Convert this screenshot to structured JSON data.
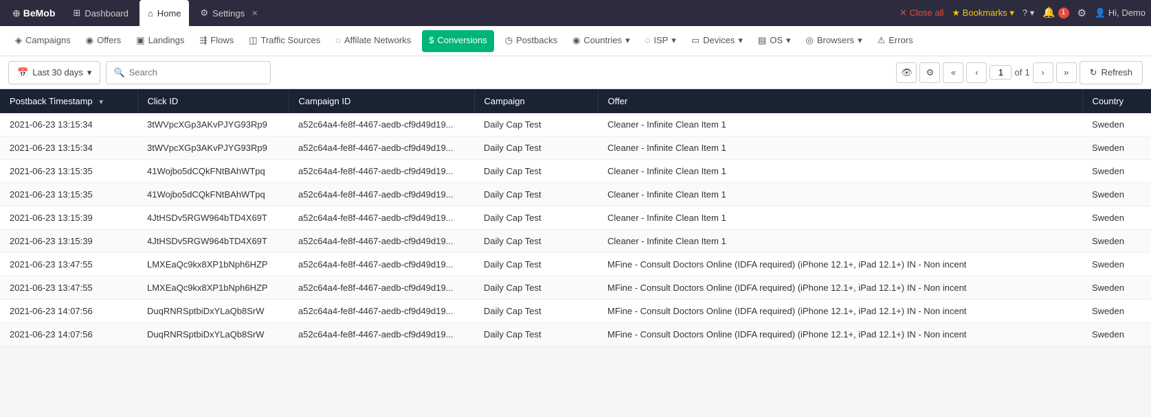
{
  "app": {
    "logo": "BeMob",
    "logo_icon": "⊕"
  },
  "tabs": [
    {
      "id": "dashboard",
      "label": "Dashboard",
      "icon": "⊞",
      "active": false,
      "closable": false
    },
    {
      "id": "home",
      "label": "Home",
      "icon": "⌂",
      "active": true,
      "closable": false
    },
    {
      "id": "settings",
      "label": "Settings",
      "icon": "⚙",
      "active": false,
      "closable": true
    }
  ],
  "topbar_right": {
    "close_all": "Close all",
    "bookmarks": "Bookmarks",
    "help_icon": "?",
    "notification_count": "1",
    "settings_icon": "⚙",
    "user": "Hi, Demo"
  },
  "navbar": {
    "items": [
      {
        "id": "campaigns",
        "label": "Campaigns",
        "icon": "◈"
      },
      {
        "id": "offers",
        "label": "Offers",
        "icon": "◉"
      },
      {
        "id": "landings",
        "label": "Landings",
        "icon": "▣"
      },
      {
        "id": "flows",
        "label": "Flows",
        "icon": "⇶"
      },
      {
        "id": "traffic-sources",
        "label": "Traffic Sources",
        "icon": "◫"
      },
      {
        "id": "affiliate-networks",
        "label": "Affilate Networks",
        "icon": "◌"
      },
      {
        "id": "conversions",
        "label": "Conversions",
        "icon": "$",
        "active": true
      },
      {
        "id": "postbacks",
        "label": "Postbacks",
        "icon": "◷"
      },
      {
        "id": "countries",
        "label": "Countries",
        "icon": "◉"
      },
      {
        "id": "isp",
        "label": "ISP",
        "icon": "◌"
      },
      {
        "id": "devices",
        "label": "Devices",
        "icon": "▭"
      },
      {
        "id": "os",
        "label": "OS",
        "icon": "▤"
      },
      {
        "id": "browsers",
        "label": "Browsers",
        "icon": "◎"
      },
      {
        "id": "errors",
        "label": "Errors",
        "icon": "⚠"
      }
    ]
  },
  "toolbar": {
    "date_range": "Last 30 days",
    "search_placeholder": "Search",
    "refresh_label": "Refresh",
    "page_current": "1",
    "page_total": "1"
  },
  "table": {
    "columns": [
      {
        "id": "timestamp",
        "label": "Postback Timestamp",
        "sortable": true
      },
      {
        "id": "clickid",
        "label": "Click ID",
        "sortable": false
      },
      {
        "id": "campaignid",
        "label": "Campaign ID",
        "sortable": false
      },
      {
        "id": "campaign",
        "label": "Campaign",
        "sortable": false
      },
      {
        "id": "offer",
        "label": "Offer",
        "sortable": false
      },
      {
        "id": "country",
        "label": "Country",
        "sortable": false
      }
    ],
    "rows": [
      {
        "timestamp": "2021-06-23 13:15:34",
        "clickid": "3tWVpcXGp3AKvPJYG93Rp9",
        "campaignid": "a52c64a4-fe8f-4467-aedb-cf9d49d19...",
        "campaign": "Daily Cap Test",
        "offer": "Cleaner - Infinite Clean Item 1",
        "country": "Sweden"
      },
      {
        "timestamp": "2021-06-23 13:15:34",
        "clickid": "3tWVpcXGp3AKvPJYG93Rp9",
        "campaignid": "a52c64a4-fe8f-4467-aedb-cf9d49d19...",
        "campaign": "Daily Cap Test",
        "offer": "Cleaner - Infinite Clean Item 1",
        "country": "Sweden"
      },
      {
        "timestamp": "2021-06-23 13:15:35",
        "clickid": "41Wojbo5dCQkFNtBAhWTpq",
        "campaignid": "a52c64a4-fe8f-4467-aedb-cf9d49d19...",
        "campaign": "Daily Cap Test",
        "offer": "Cleaner - Infinite Clean Item 1",
        "country": "Sweden"
      },
      {
        "timestamp": "2021-06-23 13:15:35",
        "clickid": "41Wojbo5dCQkFNtBAhWTpq",
        "campaignid": "a52c64a4-fe8f-4467-aedb-cf9d49d19...",
        "campaign": "Daily Cap Test",
        "offer": "Cleaner - Infinite Clean Item 1",
        "country": "Sweden"
      },
      {
        "timestamp": "2021-06-23 13:15:39",
        "clickid": "4JtHSDv5RGW964bTD4X69T",
        "campaignid": "a52c64a4-fe8f-4467-aedb-cf9d49d19...",
        "campaign": "Daily Cap Test",
        "offer": "Cleaner - Infinite Clean Item 1",
        "country": "Sweden"
      },
      {
        "timestamp": "2021-06-23 13:15:39",
        "clickid": "4JtHSDv5RGW964bTD4X69T",
        "campaignid": "a52c64a4-fe8f-4467-aedb-cf9d49d19...",
        "campaign": "Daily Cap Test",
        "offer": "Cleaner - Infinite Clean Item 1",
        "country": "Sweden"
      },
      {
        "timestamp": "2021-06-23 13:47:55",
        "clickid": "LMXEaQc9kx8XP1bNph6HZP",
        "campaignid": "a52c64a4-fe8f-4467-aedb-cf9d49d19...",
        "campaign": "Daily Cap Test",
        "offer": "MFine - Consult Doctors Online (IDFA required) (iPhone 12.1+, iPad 12.1+) IN - Non incent",
        "country": "Sweden"
      },
      {
        "timestamp": "2021-06-23 13:47:55",
        "clickid": "LMXEaQc9kx8XP1bNph6HZP",
        "campaignid": "a52c64a4-fe8f-4467-aedb-cf9d49d19...",
        "campaign": "Daily Cap Test",
        "offer": "MFine - Consult Doctors Online (IDFA required) (iPhone 12.1+, iPad 12.1+) IN - Non incent",
        "country": "Sweden"
      },
      {
        "timestamp": "2021-06-23 14:07:56",
        "clickid": "DuqRNRSptbiDxYLaQb8SrW",
        "campaignid": "a52c64a4-fe8f-4467-aedb-cf9d49d19...",
        "campaign": "Daily Cap Test",
        "offer": "MFine - Consult Doctors Online (IDFA required) (iPhone 12.1+, iPad 12.1+) IN - Non incent",
        "country": "Sweden"
      },
      {
        "timestamp": "2021-06-23 14:07:56",
        "clickid": "DuqRNRSptbiDxYLaQb8SrW",
        "campaignid": "a52c64a4-fe8f-4467-aedb-cf9d49d19...",
        "campaign": "Daily Cap Test",
        "offer": "MFine - Consult Doctors Online (IDFA required) (iPhone 12.1+, iPad 12.1+) IN - Non incent",
        "country": "Sweden"
      }
    ]
  }
}
